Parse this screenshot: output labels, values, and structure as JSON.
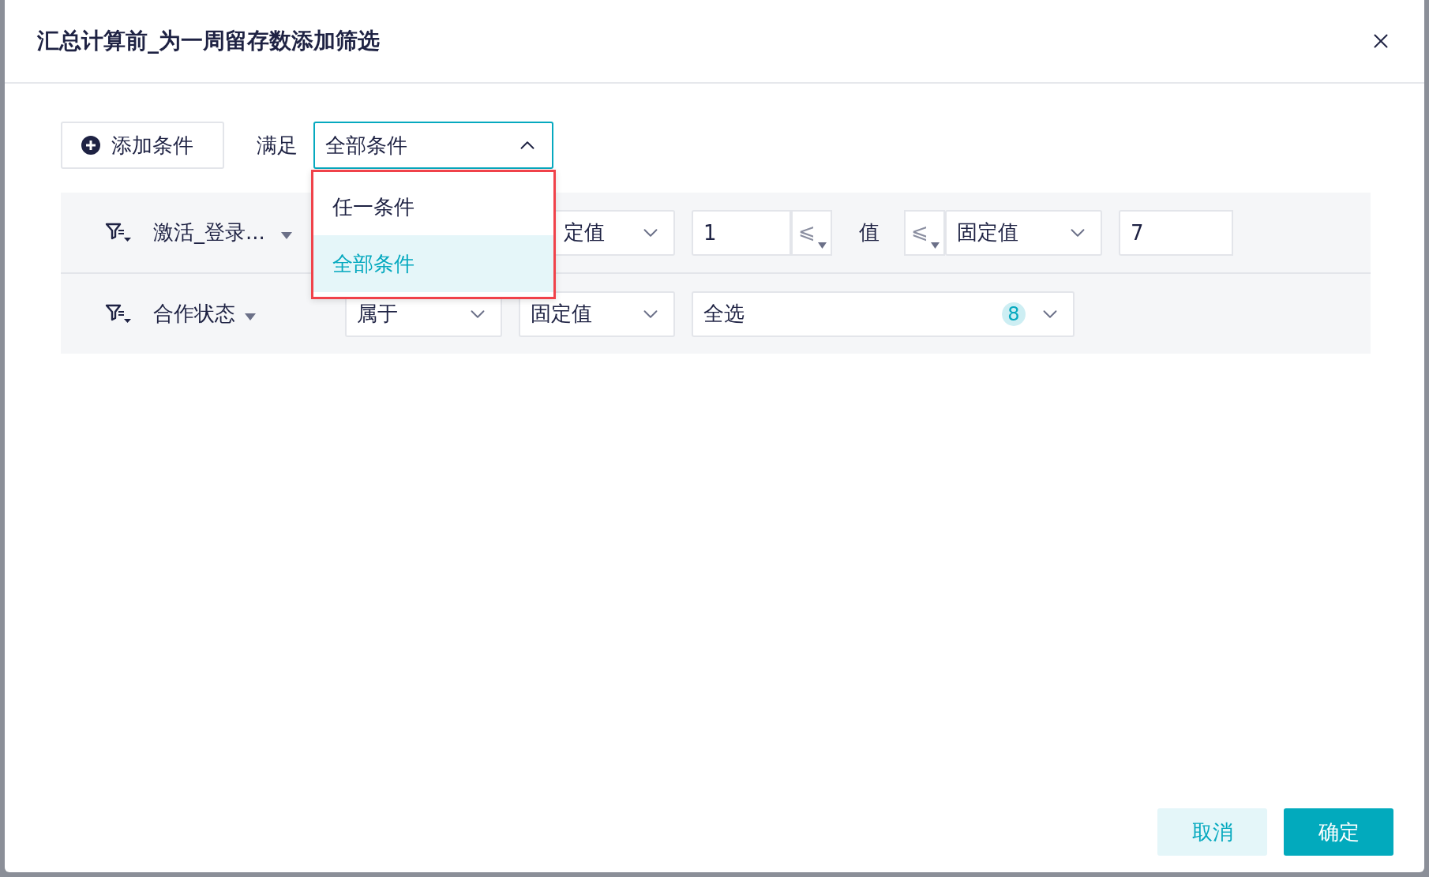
{
  "dialog": {
    "title": "汇总计算前_为一周留存数添加筛选"
  },
  "toolbar": {
    "add_button": "添加条件",
    "match_label": "满足",
    "match_select": {
      "value": "全部条件",
      "expanded": true,
      "options": [
        {
          "label": "任一条件",
          "selected": false
        },
        {
          "label": "全部条件",
          "selected": true
        }
      ]
    }
  },
  "conditions": [
    {
      "kind": "range",
      "field": "激活_登录...",
      "value_type": "定值",
      "lower": "1",
      "lower_op": "⩽",
      "mid_label": "值",
      "upper_op": "⩽",
      "upper_type": "固定值",
      "upper": "7"
    },
    {
      "kind": "set",
      "field": "合作状态",
      "operator": "属于",
      "value_type": "固定值",
      "value": "全选",
      "count": "8"
    }
  ],
  "footer": {
    "cancel": "取消",
    "confirm": "确定"
  }
}
